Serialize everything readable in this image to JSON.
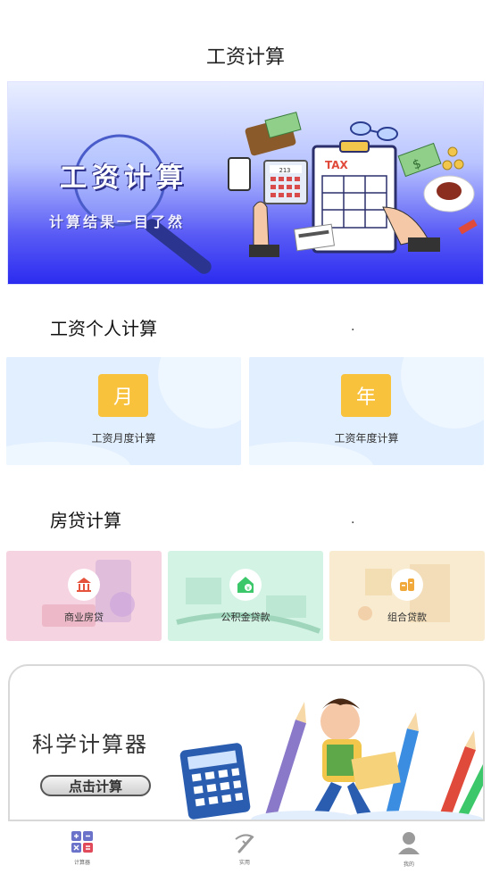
{
  "header": {
    "title": "工资计算"
  },
  "banner": {
    "title": "工资计算",
    "subtitle": "计算结果一目了然",
    "tax_label": "TAX",
    "calculator_display": "213"
  },
  "salary_section": {
    "title": "工资个人计算",
    "dot": ".",
    "cards": [
      {
        "badge": "月",
        "label": "工资月度计算"
      },
      {
        "badge": "年",
        "label": "工资年度计算"
      }
    ]
  },
  "loan_section": {
    "title": "房贷计算",
    "dot": ".",
    "cards": [
      {
        "label": "商业房贷",
        "icon": "bank-icon",
        "color": "#f6d3e0"
      },
      {
        "label": "公积金贷款",
        "icon": "house-fund-icon",
        "color": "#d3f3e4"
      },
      {
        "label": "组合贷款",
        "icon": "coins-icon",
        "color": "#f8ebcf"
      }
    ]
  },
  "sci_calc": {
    "title": "科学计算器",
    "button_label": "点击计算"
  },
  "tabbar": {
    "items": [
      {
        "label": "计算器",
        "icon": "calculator-icon"
      },
      {
        "label": "实用",
        "icon": "tools-icon"
      },
      {
        "label": "我的",
        "icon": "user-icon"
      }
    ]
  },
  "colors": {
    "accent": "#5b57f2",
    "badge": "#f8c23c",
    "salary_card": "#e1efff",
    "bank_red": "#e5533c",
    "fund_green": "#3cc76a",
    "combo_orange": "#f0a93a"
  }
}
